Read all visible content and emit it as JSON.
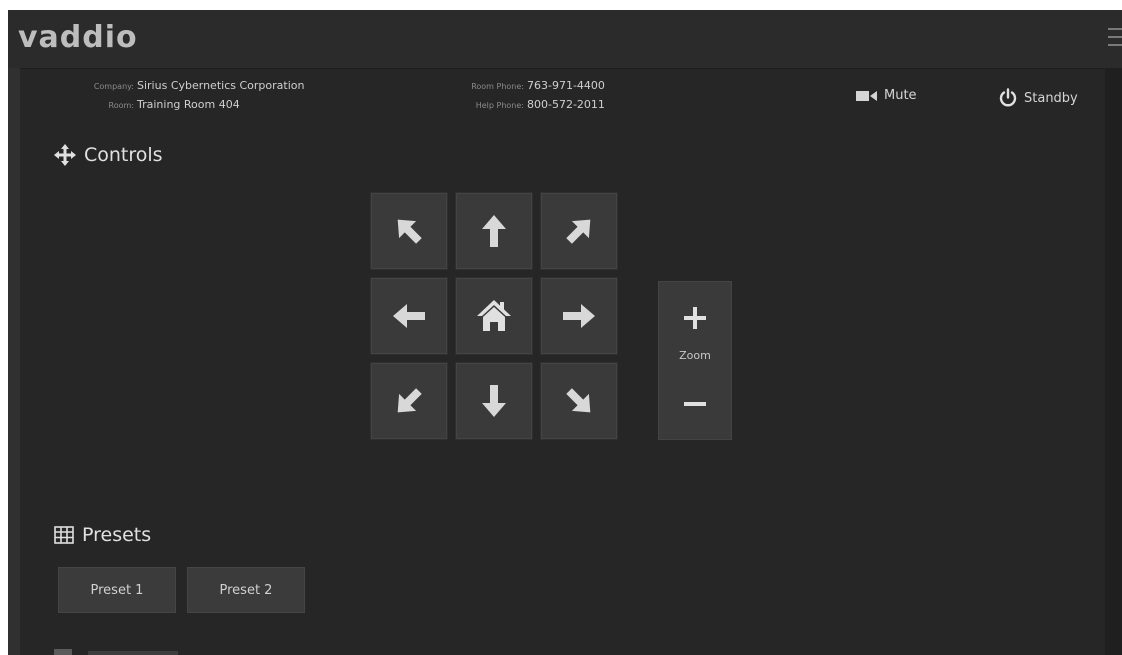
{
  "header": {
    "logo_text": "vaddio"
  },
  "info": {
    "company_label": "Company:",
    "company_value": "Sirius Cybernetics Corporation",
    "room_label": "Room:",
    "room_value": "Training Room 404",
    "room_phone_label": "Room Phone:",
    "room_phone_value": "763-971-4400",
    "help_phone_label": "Help Phone:",
    "help_phone_value": "800-572-2011"
  },
  "top_controls": {
    "mute_label": "Mute",
    "standby_label": "Standby"
  },
  "controls": {
    "title": "Controls",
    "zoom_label": "Zoom"
  },
  "presets": {
    "title": "Presets",
    "items": [
      {
        "label": "Preset 1"
      },
      {
        "label": "Preset 2"
      }
    ]
  },
  "colors": {
    "background": "#262626",
    "button": "#3a3a3a",
    "icon": "#d8d8d8"
  }
}
